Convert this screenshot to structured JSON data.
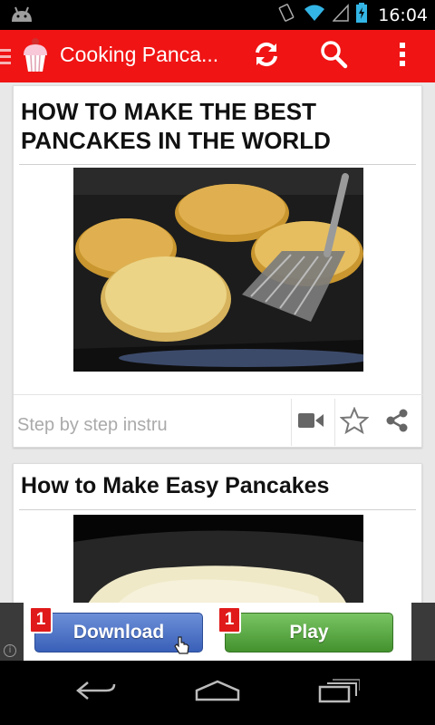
{
  "status_bar": {
    "time": "16:04"
  },
  "action_bar": {
    "title": "Cooking Panca..."
  },
  "cards": [
    {
      "title": "HOW TO MAKE THE BEST PANCAKES IN THE WORLD",
      "footer_text": "Step by step instru"
    },
    {
      "title": "How to Make Easy Pancakes"
    }
  ],
  "ad": {
    "download_label": "Download",
    "play_label": "Play",
    "download_badge": "1",
    "play_badge": "1",
    "info_symbol": "i"
  },
  "colors": {
    "action_bar": "#f01414",
    "status_bar": "#000000"
  },
  "icons": [
    "android-icon",
    "wifi-icon",
    "signal-icon",
    "battery-icon",
    "drawer-icon",
    "cupcake-icon",
    "refresh-icon",
    "search-icon",
    "overflow-menu-icon",
    "video-icon",
    "star-icon",
    "share-icon",
    "back-icon",
    "home-icon",
    "recents-icon"
  ]
}
